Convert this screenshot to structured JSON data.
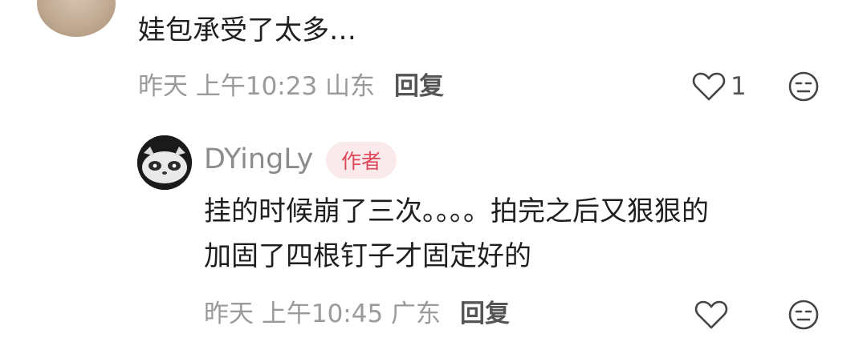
{
  "comment": {
    "text": "娃包承受了太多…",
    "meta": "昨天 上午10:23 山东",
    "reply_label": "回复",
    "like_count": "1",
    "icons": {
      "like": "heart-outline-icon",
      "dislike": "neutral-face-icon"
    }
  },
  "reply": {
    "username": "DYingLy",
    "badge": "作者",
    "text_lines": [
      "挂的时候崩了三次。。。。拍完之后又狠狠的",
      "加固了四根钉子才固定好的"
    ],
    "meta": "昨天 上午10:45 广东",
    "reply_label": "回复",
    "icons": {
      "like": "heart-outline-icon",
      "dislike": "neutral-face-icon"
    }
  },
  "colors": {
    "badge_text": "#e0475b",
    "badge_bg": "#fbeaec",
    "meta_text": "#9a9a9a"
  }
}
